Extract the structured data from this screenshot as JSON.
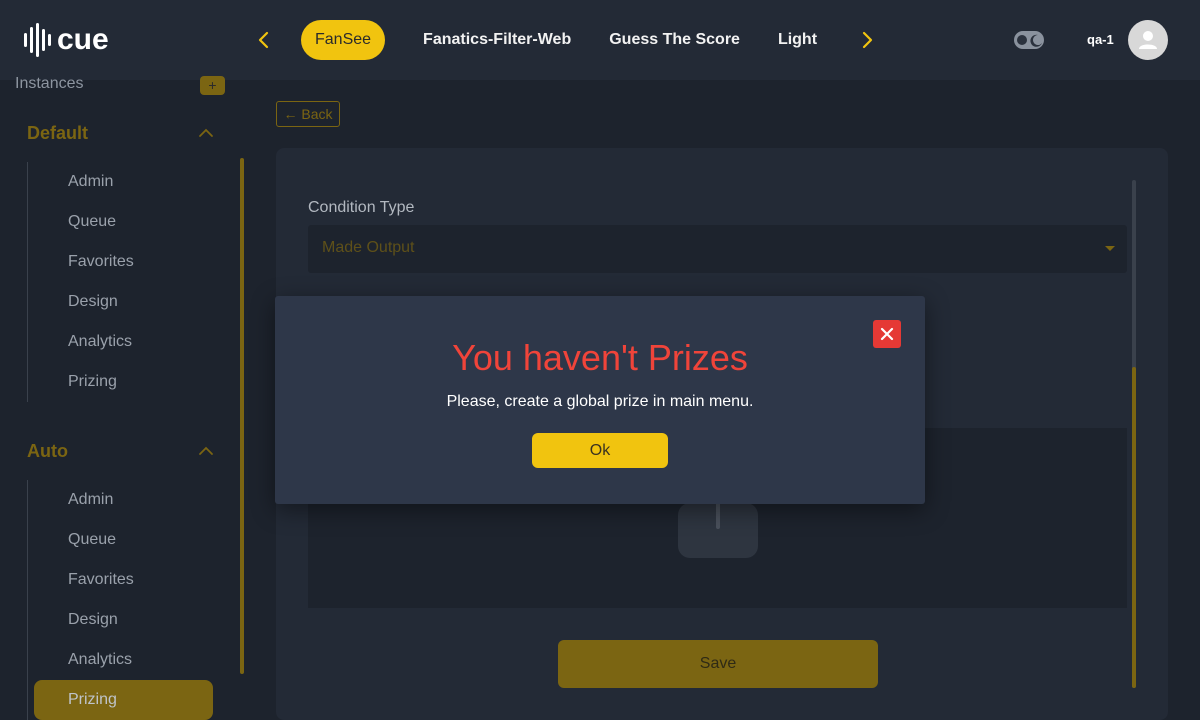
{
  "app": {
    "logo_text": "cue",
    "colors": {
      "accent": "#f1c40f",
      "accent_dim": "#7b6512",
      "topbar": "#232a36",
      "background": "#1d232d",
      "danger": "#e53935"
    }
  },
  "header": {
    "tabs": [
      {
        "label": "FanSee",
        "active": true
      },
      {
        "label": "Fanatics-Filter-Web",
        "active": false
      },
      {
        "label": "Guess The Score",
        "active": false
      },
      {
        "label": "Light",
        "active": false
      }
    ],
    "prev_icon": "chevron-left-icon",
    "next_icon": "chevron-right-icon",
    "theme_toggle_icon": "moon-icon",
    "username": "qa-1",
    "avatar_icon": "user-icon"
  },
  "sidebar": {
    "instances_label": "Instances",
    "add_label": "+",
    "sections": [
      {
        "title": "Default",
        "items": [
          "Admin",
          "Queue",
          "Favorites",
          "Design",
          "Analytics",
          "Prizing"
        ]
      },
      {
        "title": "Auto",
        "items": [
          "Admin",
          "Queue",
          "Favorites",
          "Design",
          "Analytics",
          "Prizing"
        ],
        "active_item": "Prizing"
      }
    ]
  },
  "main": {
    "back_label": "← Back",
    "condition_type_label": "Condition Type",
    "condition_type_value": "Made Output",
    "save_label": "Save"
  },
  "modal": {
    "title": "You haven't Prizes",
    "message": "Please, create a global prize in main menu.",
    "ok_label": "Ok",
    "close_icon": "close-icon"
  }
}
